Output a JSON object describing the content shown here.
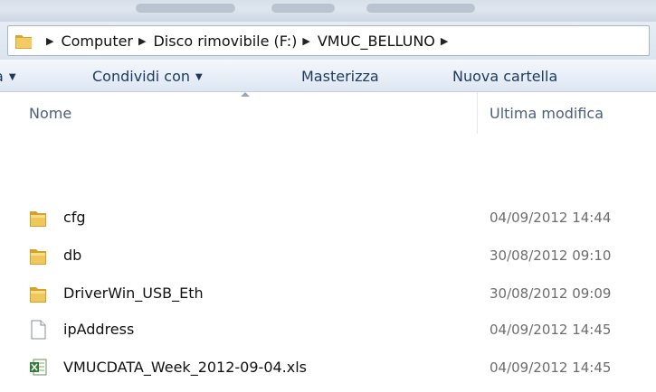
{
  "breadcrumb": {
    "items": [
      "Computer",
      "Disco rimovibile (F:)",
      "VMUC_BELLUNO"
    ]
  },
  "toolbar": {
    "partial_left_label": "a",
    "share_label": "Condividi con",
    "burn_label": "Masterizza",
    "new_folder_label": "Nuova cartella"
  },
  "columns": {
    "name": "Nome",
    "modified": "Ultima modifica"
  },
  "files": [
    {
      "name": "cfg",
      "modified": "04/09/2012 14:44",
      "icon": "folder-icon"
    },
    {
      "name": "db",
      "modified": "30/08/2012 09:10",
      "icon": "folder-icon"
    },
    {
      "name": "DriverWin_USB_Eth",
      "modified": "30/08/2012 09:09",
      "icon": "folder-icon"
    },
    {
      "name": "ipAddress",
      "modified": "04/09/2012 14:45",
      "icon": "file-icon"
    },
    {
      "name": "VMUCDATA_Week_2012-09-04.xls",
      "modified": "04/09/2012 14:45",
      "icon": "excel-file-icon"
    }
  ],
  "colors": {
    "toolbar_text": "#1e395b",
    "header_text": "#4c607a",
    "date_text": "#6d6d6d",
    "folder_yellow": "#e8b43a"
  }
}
